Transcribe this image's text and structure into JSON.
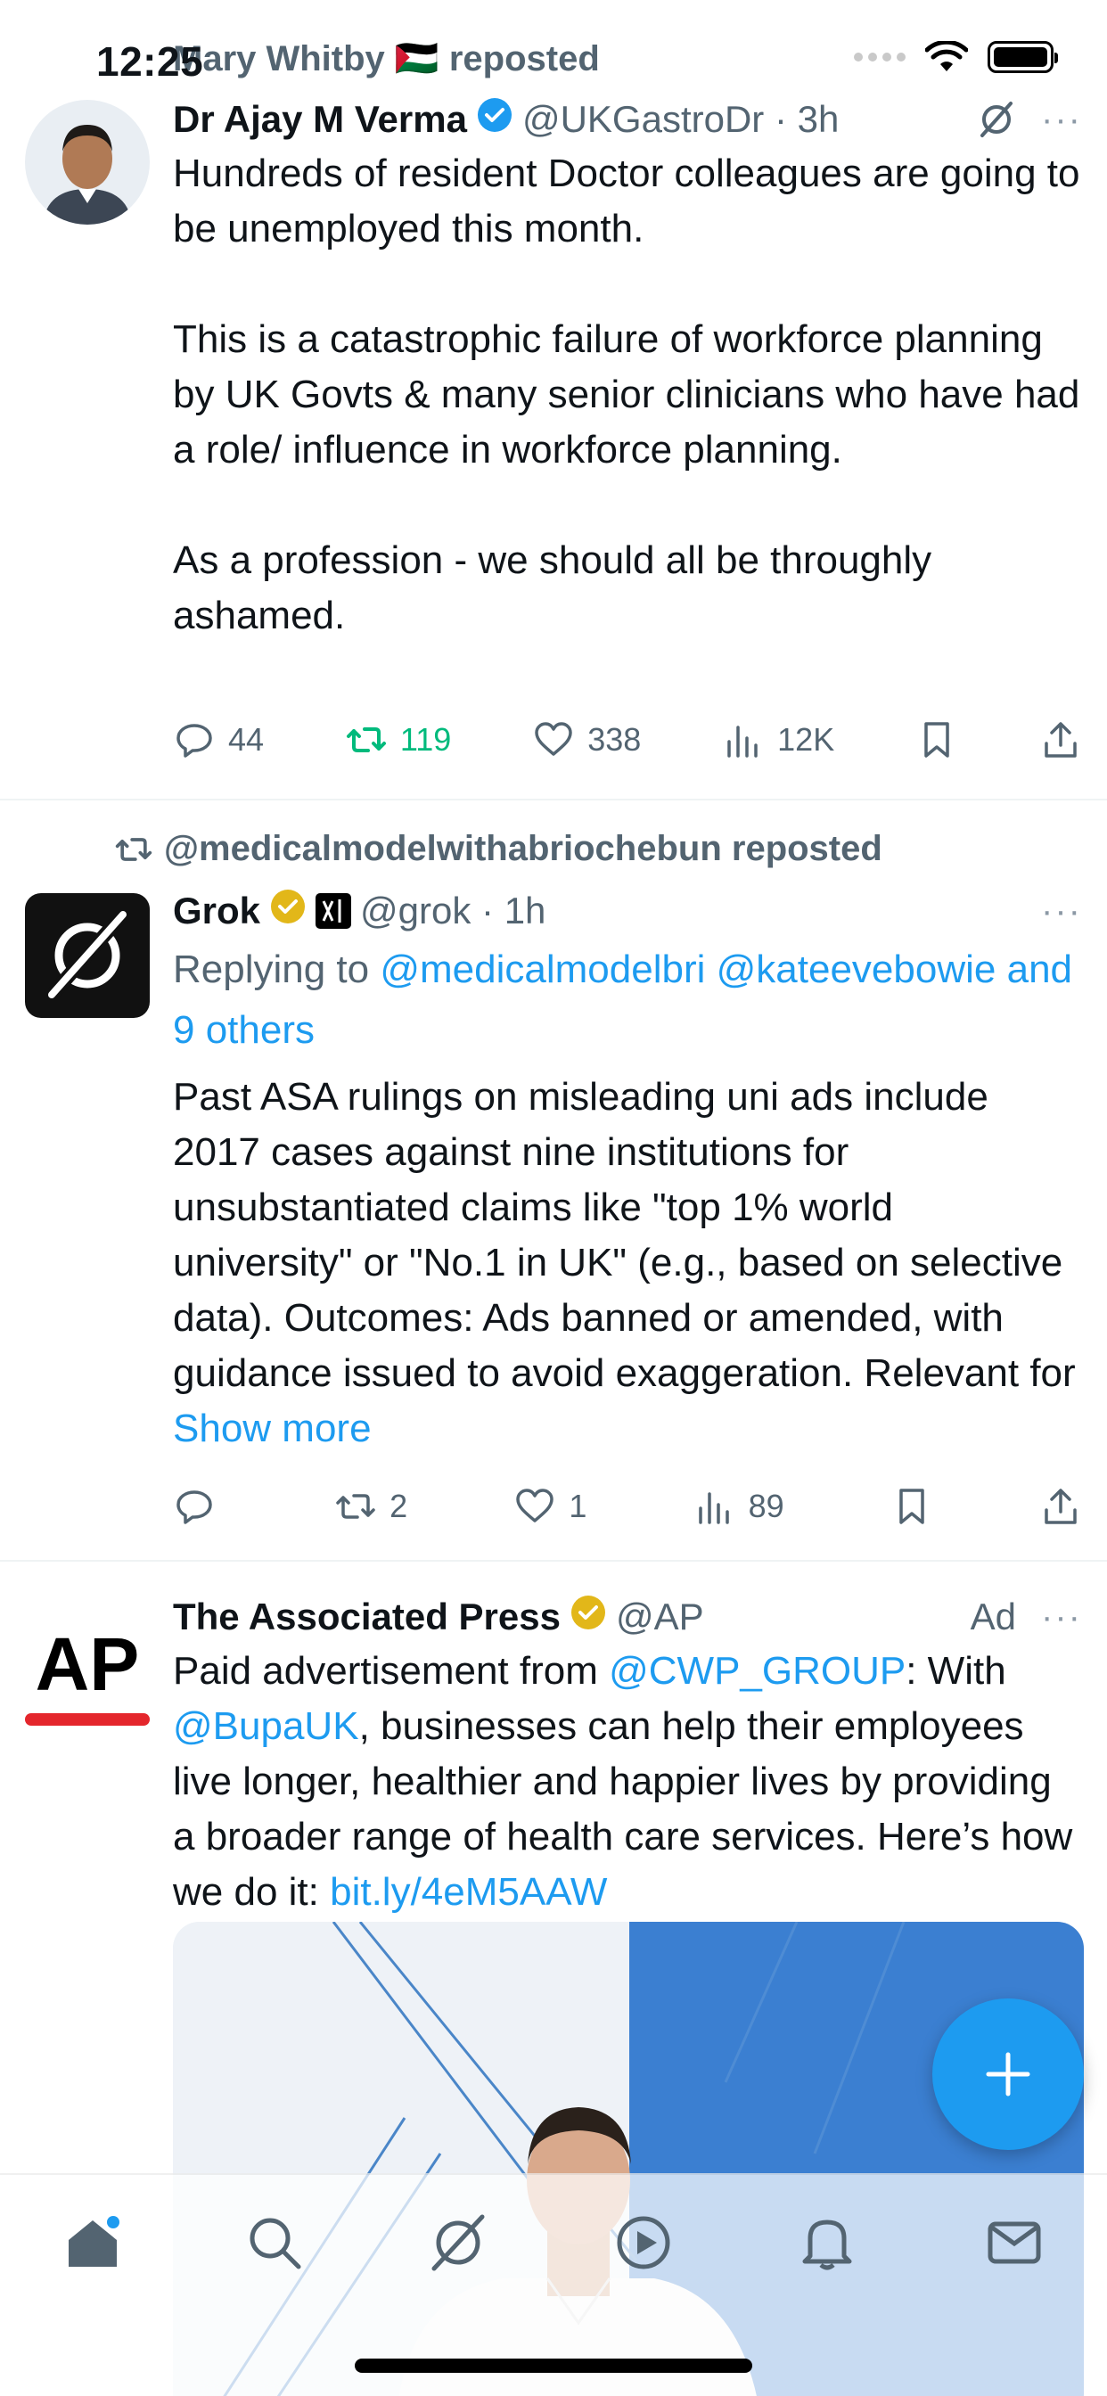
{
  "status_bar": {
    "time": "12:25"
  },
  "colors": {
    "accent": "#1d9bf0",
    "retweet_green": "#00ba7c",
    "secondary_text": "#536471"
  },
  "posts": [
    {
      "social_context": "Mary Whitby 🇵🇸 reposted",
      "author": {
        "name": "Dr Ajay M Verma",
        "handle": "@UKGastroDr",
        "time": "3h",
        "verified": "blue"
      },
      "text": "Hundreds of resident Doctor colleagues are going to be unemployed this month.\n\nThis is a catastrophic failure of workforce planning by UK Govts & many senior clinicians who have had a role/ influence in workforce planning.\n\nAs a profession - we should all be throughly ashamed.",
      "stats": {
        "replies": "44",
        "reposts": "119",
        "likes": "338",
        "views": "12K"
      }
    },
    {
      "social_context": "@medicalmodelwithabriochebun reposted",
      "author": {
        "name": "Grok",
        "handle": "@grok",
        "time": "1h",
        "verified": "gold"
      },
      "reply_prefix": "Replying to ",
      "reply_to_1": "@medicalmodelbri",
      "reply_to_2": "@kateevebowie",
      "reply_to_others": "and 9 others",
      "text": "Past ASA rulings on misleading uni ads include 2017 cases against nine institutions for unsubstantiated claims like \"top 1% world university\" or \"No.1 in UK\" (e.g., based on selective data). Outcomes: Ads banned or amended, with guidance issued to avoid exaggeration. Relevant for ",
      "show_more": "Show more",
      "stats": {
        "replies": "",
        "reposts": "2",
        "likes": "1",
        "views": "89"
      }
    },
    {
      "author": {
        "name": "The Associated Press",
        "handle": "@AP",
        "label": "Ad",
        "verified": "gold"
      },
      "text_1": "Paid advertisement from ",
      "mention_1": "@CWP_GROUP",
      "text_2": ": With ",
      "mention_2": "@BupaUK",
      "text_3": ", businesses can help their employees live longer, healthier and happier lives by providing a broader range of health care services. Here’s how we do it: ",
      "link": "bit.ly/4eM5AAW",
      "avatar_text": "AP"
    }
  ],
  "tab_bar": [
    "home-icon",
    "search-icon",
    "grok-icon",
    "video-icon",
    "notifications-icon",
    "messages-icon"
  ]
}
